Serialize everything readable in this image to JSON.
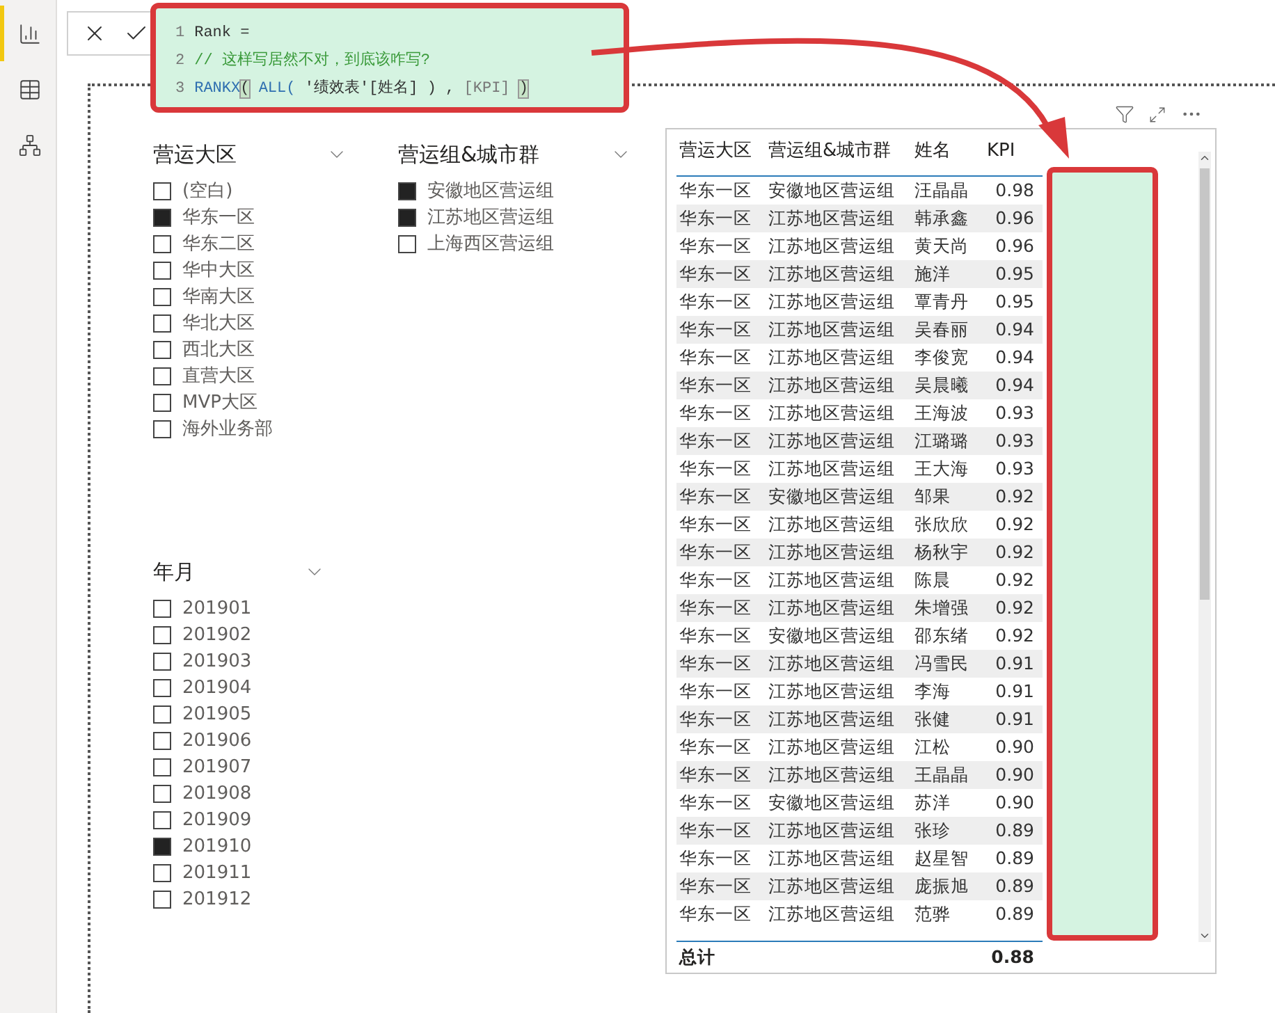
{
  "sidebar": {
    "items": [
      {
        "kind": "report",
        "selected": true
      },
      {
        "kind": "data",
        "selected": false
      },
      {
        "kind": "model",
        "selected": false
      }
    ]
  },
  "formula_bar": {
    "lines": [
      {
        "number": "1",
        "tokens": [
          {
            "text": "Rank =",
            "kind": "plain"
          }
        ]
      },
      {
        "number": "2",
        "tokens": [
          {
            "text": "// 这样写居然不对，到底该咋写?",
            "kind": "comment"
          }
        ]
      },
      {
        "number": "3",
        "tokens": [
          {
            "text": "RANKX",
            "kind": "function"
          },
          {
            "text": "(",
            "kind": "bracket"
          },
          {
            "text": " ALL( ",
            "kind": "function"
          },
          {
            "text": "'绩效表'[姓名] ) , ",
            "kind": "plain"
          },
          {
            "text": "[KPI] ",
            "kind": "measure"
          },
          {
            "text": ")",
            "kind": "bracket"
          }
        ]
      }
    ]
  },
  "slicers": [
    {
      "title": "营运大区",
      "items": [
        {
          "label": "(空白)",
          "checked": false
        },
        {
          "label": "华东一区",
          "checked": true
        },
        {
          "label": "华东二区",
          "checked": false
        },
        {
          "label": "华中大区",
          "checked": false
        },
        {
          "label": "华南大区",
          "checked": false
        },
        {
          "label": "华北大区",
          "checked": false
        },
        {
          "label": "西北大区",
          "checked": false
        },
        {
          "label": "直营大区",
          "checked": false
        },
        {
          "label": "MVP大区",
          "checked": false
        },
        {
          "label": "海外业务部",
          "checked": false
        }
      ]
    },
    {
      "title": "营运组&城市群",
      "items": [
        {
          "label": "安徽地区营运组",
          "checked": true
        },
        {
          "label": "江苏地区营运组",
          "checked": true
        },
        {
          "label": "上海西区营运组",
          "checked": false
        }
      ]
    },
    {
      "title": "年月",
      "items": [
        {
          "label": "201901",
          "checked": false
        },
        {
          "label": "201902",
          "checked": false
        },
        {
          "label": "201903",
          "checked": false
        },
        {
          "label": "201904",
          "checked": false
        },
        {
          "label": "201905",
          "checked": false
        },
        {
          "label": "201906",
          "checked": false
        },
        {
          "label": "201907",
          "checked": false
        },
        {
          "label": "201908",
          "checked": false
        },
        {
          "label": "201909",
          "checked": false
        },
        {
          "label": "201910",
          "checked": true
        },
        {
          "label": "201911",
          "checked": false
        },
        {
          "label": "201912",
          "checked": false
        }
      ]
    }
  ],
  "table": {
    "columns": [
      "营运大区",
      "营运组&城市群",
      "姓名",
      "KPI"
    ],
    "rows": [
      [
        "华东一区",
        "安徽地区营运组",
        "汪晶晶",
        "0.98"
      ],
      [
        "华东一区",
        "江苏地区营运组",
        "韩承鑫",
        "0.96"
      ],
      [
        "华东一区",
        "江苏地区营运组",
        "黄天尚",
        "0.96"
      ],
      [
        "华东一区",
        "江苏地区营运组",
        "施洋",
        "0.95"
      ],
      [
        "华东一区",
        "江苏地区营运组",
        "覃青丹",
        "0.95"
      ],
      [
        "华东一区",
        "江苏地区营运组",
        "吴春丽",
        "0.94"
      ],
      [
        "华东一区",
        "江苏地区营运组",
        "李俊宽",
        "0.94"
      ],
      [
        "华东一区",
        "江苏地区营运组",
        "吴晨曦",
        "0.94"
      ],
      [
        "华东一区",
        "江苏地区营运组",
        "王海波",
        "0.93"
      ],
      [
        "华东一区",
        "江苏地区营运组",
        "江璐璐",
        "0.93"
      ],
      [
        "华东一区",
        "江苏地区营运组",
        "王大海",
        "0.93"
      ],
      [
        "华东一区",
        "安徽地区营运组",
        "邹果",
        "0.92"
      ],
      [
        "华东一区",
        "江苏地区营运组",
        "张欣欣",
        "0.92"
      ],
      [
        "华东一区",
        "江苏地区营运组",
        "杨秋宇",
        "0.92"
      ],
      [
        "华东一区",
        "江苏地区营运组",
        "陈晨",
        "0.92"
      ],
      [
        "华东一区",
        "江苏地区营运组",
        "朱增强",
        "0.92"
      ],
      [
        "华东一区",
        "安徽地区营运组",
        "邵东绪",
        "0.92"
      ],
      [
        "华东一区",
        "江苏地区营运组",
        "冯雪民",
        "0.91"
      ],
      [
        "华东一区",
        "江苏地区营运组",
        "李海",
        "0.91"
      ],
      [
        "华东一区",
        "江苏地区营运组",
        "张健",
        "0.91"
      ],
      [
        "华东一区",
        "江苏地区营运组",
        "江松",
        "0.90"
      ],
      [
        "华东一区",
        "江苏地区营运组",
        "王晶晶",
        "0.90"
      ],
      [
        "华东一区",
        "安徽地区营运组",
        "苏洋",
        "0.90"
      ],
      [
        "华东一区",
        "江苏地区营运组",
        "张珍",
        "0.89"
      ],
      [
        "华东一区",
        "江苏地区营运组",
        "赵星智",
        "0.89"
      ],
      [
        "华东一区",
        "江苏地区营运组",
        "庞振旭",
        "0.89"
      ],
      [
        "华东一区",
        "江苏地区营运组",
        "范骅",
        "0.89"
      ]
    ],
    "total": {
      "label": "总计",
      "value": "0.88"
    }
  }
}
